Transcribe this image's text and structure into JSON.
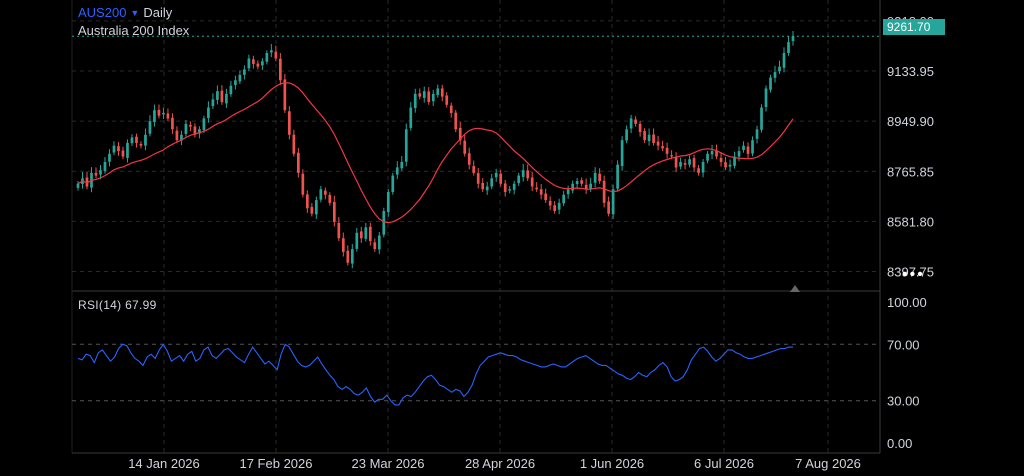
{
  "header": {
    "symbol": "AUS200",
    "timeframe": "Daily",
    "instrument_name": "Australia 200 Index",
    "dropdown_icon": "triangle-down-icon"
  },
  "price_tag": {
    "value": "9261.70",
    "color": "#26a69a"
  },
  "rsi": {
    "label": "RSI(14) 67.99",
    "color": "#2962ff"
  },
  "more_icon": "ellipsis-icon",
  "colors": {
    "up": "#26a69a",
    "down": "#ef5350",
    "ma": "#f23645",
    "grid": "#2a2a2a",
    "bg": "#000000"
  },
  "chart_data": [
    {
      "type": "candlestick",
      "price_axis_ticks": [
        "9318.00",
        "9133.95",
        "8949.90",
        "8765.85",
        "8581.80",
        "8397.75"
      ],
      "ylim": [
        8330,
        9380
      ],
      "x_tick_labels": [
        "14 Jan 2026",
        "17 Feb 2026",
        "23 Mar 2026",
        "28 Apr 2026",
        "1 Jun 2026",
        "6 Jul 2026",
        "7 Aug 2026"
      ],
      "close": [
        8720,
        8740,
        8710,
        8760,
        8750,
        8770,
        8800,
        8830,
        8860,
        8840,
        8820,
        8870,
        8890,
        8870,
        8860,
        8900,
        8950,
        8990,
        8970,
        8980,
        8960,
        8920,
        8880,
        8900,
        8940,
        8930,
        8900,
        8920,
        8960,
        9000,
        9030,
        9060,
        9020,
        9050,
        9080,
        9100,
        9120,
        9140,
        9180,
        9160,
        9150,
        9170,
        9200,
        9210,
        9180,
        9100,
        8990,
        8900,
        8830,
        8760,
        8680,
        8630,
        8610,
        8660,
        8700,
        8680,
        8650,
        8580,
        8520,
        8470,
        8430,
        8480,
        8540,
        8520,
        8560,
        8510,
        8480,
        8530,
        8620,
        8690,
        8750,
        8780,
        8800,
        8920,
        9000,
        9050,
        9040,
        9060,
        9020,
        9050,
        9070,
        9040,
        9010,
        8980,
        8920,
        8880,
        8830,
        8790,
        8760,
        8720,
        8700,
        8710,
        8740,
        8760,
        8720,
        8690,
        8700,
        8720,
        8750,
        8770,
        8740,
        8710,
        8700,
        8680,
        8660,
        8640,
        8620,
        8650,
        8680,
        8700,
        8720,
        8730,
        8720,
        8700,
        8720,
        8760,
        8730,
        8650,
        8610,
        8700,
        8790,
        8880,
        8920,
        8960,
        8940,
        8910,
        8880,
        8900,
        8870,
        8860,
        8850,
        8830,
        8820,
        8780,
        8800,
        8790,
        8810,
        8780,
        8760,
        8800,
        8830,
        8840,
        8820,
        8800,
        8780,
        8790,
        8820,
        8840,
        8860,
        8830,
        8880,
        8920,
        9000,
        9070,
        9110,
        9130,
        9150,
        9200,
        9240,
        9261.7
      ],
      "ma_period": 20
    },
    {
      "type": "line",
      "name": "RSI(14)",
      "ylim": [
        0,
        100
      ],
      "y_tick_labels": [
        "100.00",
        "70.00",
        "30.00",
        "0.00"
      ],
      "levels": [
        70,
        30
      ],
      "values": [
        60,
        59,
        63,
        62,
        57,
        64,
        66,
        62,
        58,
        61,
        67,
        70,
        69,
        64,
        60,
        58,
        55,
        61,
        63,
        60,
        66,
        70,
        65,
        58,
        60,
        62,
        58,
        63,
        65,
        58,
        60,
        66,
        68,
        62,
        60,
        63,
        66,
        67,
        64,
        61,
        59,
        57,
        63,
        68,
        64,
        60,
        56,
        58,
        55,
        52,
        63,
        70,
        68,
        63,
        58,
        55,
        54,
        55,
        58,
        61,
        56,
        52,
        48,
        45,
        40,
        38,
        40,
        38,
        35,
        34,
        36,
        39,
        33,
        29,
        31,
        31,
        34,
        30,
        27,
        27,
        32,
        34,
        33,
        36,
        40,
        44,
        47,
        48,
        45,
        41,
        40,
        38,
        36,
        38,
        37,
        33,
        36,
        41,
        49,
        55,
        58,
        61,
        62,
        63,
        64,
        63,
        62,
        62,
        61,
        59,
        58,
        57,
        56,
        55,
        54,
        54,
        55,
        56,
        55,
        54,
        54,
        56,
        58,
        60,
        61,
        62,
        60,
        58,
        56,
        55,
        55,
        53,
        51,
        49,
        48,
        46,
        45,
        47,
        50,
        48,
        47,
        50,
        52,
        55,
        57,
        54,
        47,
        44,
        45,
        47,
        52,
        59,
        63,
        67,
        68,
        65,
        61,
        58,
        60,
        63,
        66,
        66,
        64,
        63,
        61,
        60,
        60,
        61,
        62,
        63,
        64,
        65,
        66,
        67,
        67,
        68,
        68
      ]
    }
  ]
}
